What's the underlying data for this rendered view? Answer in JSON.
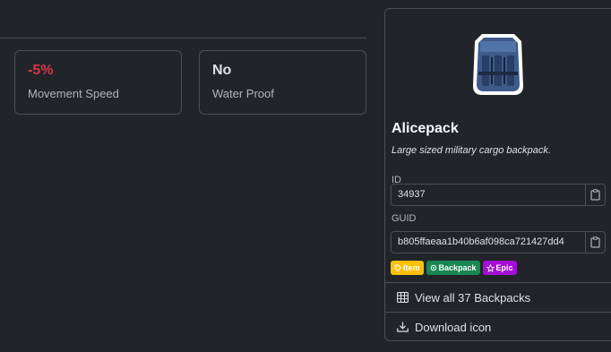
{
  "stats": [
    {
      "value": "-5%",
      "label": "Movement Speed"
    },
    {
      "value": "No",
      "label": "Water Proof"
    }
  ],
  "item": {
    "name": "Alicepack",
    "description": "Large sized military cargo backpack.",
    "id_label": "ID",
    "id_value": "34937",
    "guid_label": "GUID",
    "guid_value": "b805ffaeaa1b40b6af098ca721427dd4",
    "image_icon": "backpack-icon"
  },
  "badges": [
    {
      "label": "Item",
      "icon": "tag-icon"
    },
    {
      "label": "Backpack",
      "icon": "gear-icon"
    },
    {
      "label": "Epic",
      "icon": "star-icon"
    }
  ],
  "actions": {
    "view_all": "View all 37 Backpacks",
    "download": "Download icon"
  },
  "colors": {
    "background": "#212529",
    "border": "#495057",
    "negative": "#dc3545",
    "badge_item": "#ffc107",
    "badge_backpack": "#198754",
    "badge_epic": "#a50ed6"
  }
}
